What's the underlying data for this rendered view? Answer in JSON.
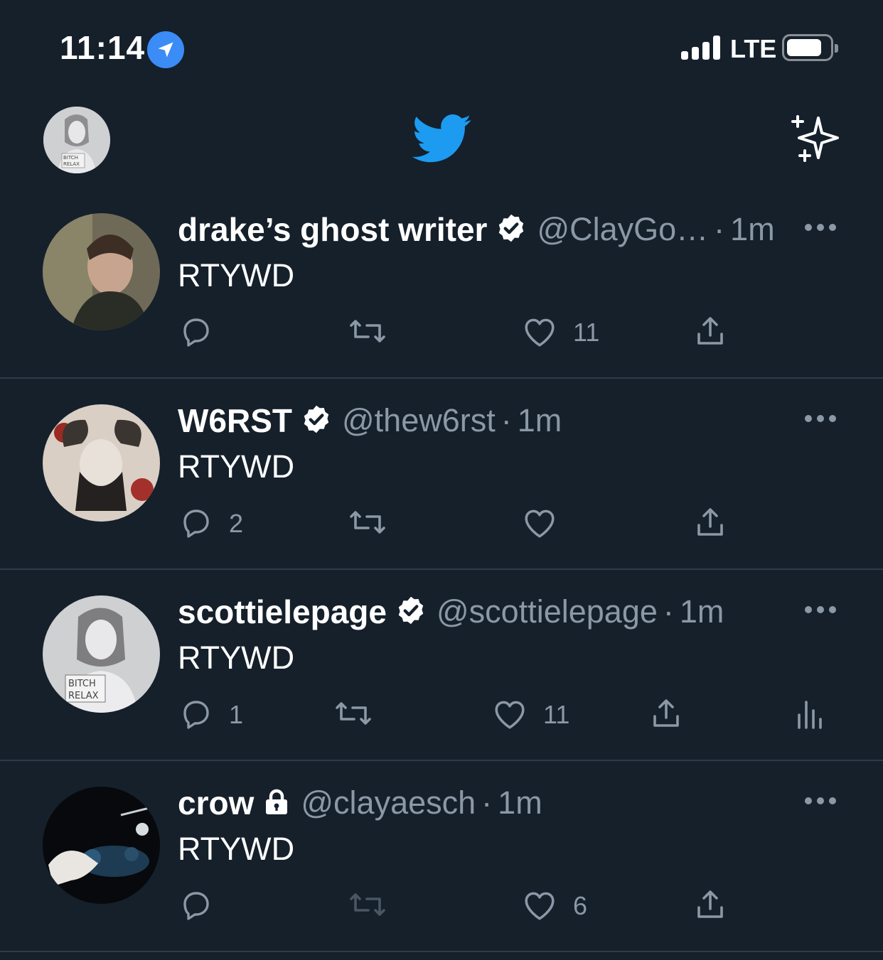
{
  "status_bar": {
    "time": "11:14",
    "network": "LTE"
  },
  "header": {
    "logo_icon": "twitter-bird-icon",
    "right_icon": "sparkle-icon",
    "brand_color": "#1d9bf0"
  },
  "tweets": [
    {
      "name": "drake’s ghost writer",
      "badge": "verified-badge-icon",
      "handle": "@ClayGo…",
      "time": "1m",
      "text": "RTYWD",
      "replies": "",
      "likes": "11",
      "retweet_enabled": true,
      "analytics": false
    },
    {
      "name": "W6RST",
      "badge": "verified-badge-icon",
      "handle": "@thew6rst",
      "time": "1m",
      "text": "RTYWD",
      "replies": "2",
      "likes": "",
      "retweet_enabled": true,
      "analytics": false
    },
    {
      "name": "scottielepage",
      "badge": "verified-badge-icon",
      "handle": "@scottielepage",
      "time": "1m",
      "text": "RTYWD",
      "replies": "1",
      "likes": "11",
      "retweet_enabled": true,
      "analytics": true
    },
    {
      "name": "crow",
      "badge": "lock-icon",
      "handle": "@clayaesch",
      "time": "1m",
      "text": "RTYWD",
      "replies": "",
      "likes": "6",
      "retweet_enabled": false,
      "analytics": false
    }
  ]
}
